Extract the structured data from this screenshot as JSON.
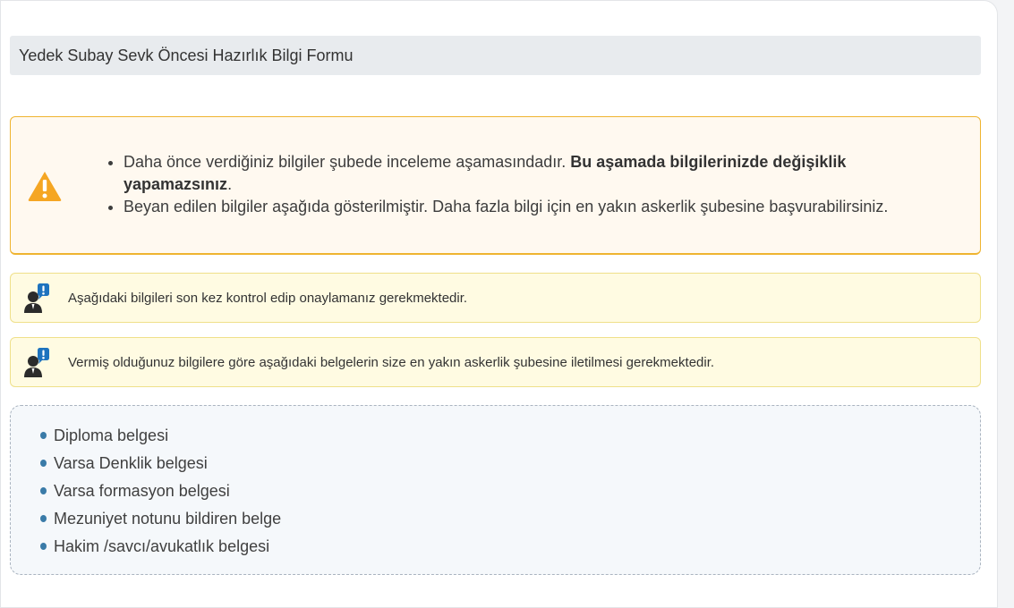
{
  "header": {
    "title": "Yedek Subay Sevk Öncesi Hazırlık Bilgi Formu"
  },
  "warning": {
    "icon": "warning-triangle-icon",
    "item1_text": "Daha önce verdiğiniz bilgiler şubede inceleme aşamasındadır. ",
    "item1_bold": "Bu aşamada bilgilerinizde değişiklik yapamazsınız",
    "item1_end": ".",
    "item2_text": "Beyan edilen bilgiler aşağıda gösterilmiştir. Daha fazla bilgi için en yakın askerlik şubesine başvurabilirsiniz."
  },
  "notices": [
    {
      "icon": "person-alert-icon",
      "text": "Aşağıdaki bilgileri son kez kontrol edip onaylamanız gerekmektedir."
    },
    {
      "icon": "person-alert-icon",
      "text": "Vermiş olduğunuz bilgilere göre aşağıdaki belgelerin size en yakın askerlik şubesine iletilmesi gerekmektedir."
    }
  ],
  "documents": [
    "Diploma belgesi",
    "Varsa Denklik belgesi",
    "Varsa formasyon belgesi",
    "Mezuniyet notunu bildiren belge",
    "Hakim /savcı/avukatlık belgesi"
  ],
  "colors": {
    "warning_border": "#efb430",
    "warning_icon": "#f5a623",
    "notice_bg": "#fffbe2",
    "bullet": "#3a7ba8",
    "alert_badge": "#1e73be"
  }
}
